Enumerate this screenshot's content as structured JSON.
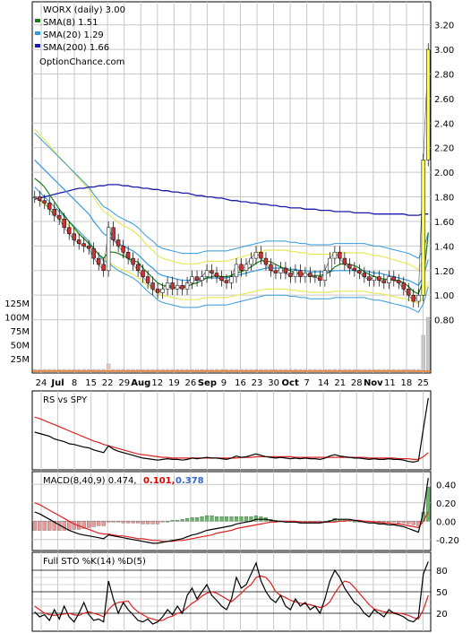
{
  "chart_data": [
    {
      "type": "candlestick",
      "panel": "price",
      "title": "WORX (daily) 3.00",
      "watermark": "OptionChance.com",
      "legend": [
        {
          "label": "SMA(8) 1.51",
          "color": "#1a7a1a"
        },
        {
          "label": "SMA(20) 1.29",
          "color": "#3399dd"
        },
        {
          "label": "SMA(200) 1.66",
          "color": "#1a1aaa"
        }
      ],
      "y_ticks": [
        "0.80",
        "1.00",
        "1.20",
        "1.40",
        "1.60",
        "1.80",
        "2.00",
        "2.20",
        "2.40",
        "2.60",
        "2.80",
        "3.00",
        "3.20"
      ],
      "ylim": [
        0.6,
        3.3
      ],
      "volume_ticks": [
        "125M",
        "100M",
        "75M",
        "50M",
        "25M"
      ],
      "x_ticks": [
        "24",
        "Jul",
        "8",
        "15",
        "22",
        "29",
        "Aug",
        "12",
        "19",
        "26",
        "Sep",
        "9",
        "16",
        "23",
        "30",
        "Oct",
        "7",
        "14",
        "21",
        "28",
        "Nov",
        "11",
        "18",
        "25"
      ],
      "grid": true,
      "legend_position": "top-left",
      "closes": [
        1.8,
        1.77,
        1.75,
        1.7,
        1.65,
        1.62,
        1.55,
        1.5,
        1.45,
        1.42,
        1.4,
        1.38,
        1.3,
        1.25,
        1.2,
        1.55,
        1.45,
        1.4,
        1.35,
        1.3,
        1.25,
        1.2,
        1.15,
        1.1,
        1.05,
        1.02,
        1.05,
        1.1,
        1.05,
        1.08,
        1.05,
        1.1,
        1.15,
        1.12,
        1.15,
        1.2,
        1.18,
        1.15,
        1.12,
        1.1,
        1.15,
        1.25,
        1.2,
        1.25,
        1.3,
        1.35,
        1.3,
        1.25,
        1.2,
        1.18,
        1.22,
        1.18,
        1.15,
        1.2,
        1.15,
        1.18,
        1.15,
        1.15,
        1.12,
        1.2,
        1.3,
        1.35,
        1.3,
        1.25,
        1.22,
        1.2,
        1.18,
        1.15,
        1.12,
        1.15,
        1.12,
        1.1,
        1.15,
        1.12,
        1.1,
        1.05,
        1.0,
        0.95,
        1.0,
        2.1,
        3.0
      ],
      "sma8": [
        1.95,
        1.92,
        1.88,
        1.82,
        1.76,
        1.7,
        1.65,
        1.6,
        1.55,
        1.5,
        1.46,
        1.42,
        1.38,
        1.33,
        1.3,
        1.35,
        1.35,
        1.34,
        1.32,
        1.3,
        1.28,
        1.27,
        1.22,
        1.18,
        1.14,
        1.1,
        1.08,
        1.07,
        1.06,
        1.06,
        1.06,
        1.07,
        1.09,
        1.1,
        1.12,
        1.14,
        1.15,
        1.16,
        1.15,
        1.15,
        1.16,
        1.18,
        1.19,
        1.21,
        1.23,
        1.26,
        1.28,
        1.28,
        1.27,
        1.25,
        1.23,
        1.21,
        1.2,
        1.18,
        1.18,
        1.17,
        1.16,
        1.16,
        1.16,
        1.17,
        1.19,
        1.23,
        1.25,
        1.26,
        1.25,
        1.24,
        1.22,
        1.19,
        1.17,
        1.15,
        1.14,
        1.13,
        1.13,
        1.12,
        1.12,
        1.1,
        1.07,
        1.03,
        1.01,
        1.12,
        1.51
      ],
      "sma20": [
        2.1,
        2.06,
        2.02,
        1.98,
        1.94,
        1.9,
        1.86,
        1.82,
        1.78,
        1.74,
        1.7,
        1.66,
        1.6,
        1.55,
        1.5,
        1.48,
        1.45,
        1.42,
        1.4,
        1.38,
        1.36,
        1.33,
        1.29,
        1.25,
        1.22,
        1.18,
        1.16,
        1.15,
        1.14,
        1.13,
        1.12,
        1.12,
        1.12,
        1.12,
        1.13,
        1.14,
        1.14,
        1.14,
        1.14,
        1.14,
        1.15,
        1.16,
        1.17,
        1.18,
        1.19,
        1.2,
        1.21,
        1.22,
        1.22,
        1.22,
        1.22,
        1.22,
        1.21,
        1.21,
        1.2,
        1.2,
        1.19,
        1.19,
        1.19,
        1.19,
        1.19,
        1.2,
        1.2,
        1.2,
        1.2,
        1.2,
        1.2,
        1.2,
        1.19,
        1.18,
        1.18,
        1.17,
        1.16,
        1.15,
        1.14,
        1.13,
        1.12,
        1.1,
        1.08,
        1.15,
        1.29
      ],
      "sma200": [
        1.78,
        1.79,
        1.8,
        1.81,
        1.82,
        1.83,
        1.84,
        1.85,
        1.86,
        1.87,
        1.87,
        1.88,
        1.88,
        1.89,
        1.89,
        1.9,
        1.9,
        1.9,
        1.89,
        1.89,
        1.88,
        1.88,
        1.87,
        1.87,
        1.86,
        1.86,
        1.85,
        1.85,
        1.84,
        1.84,
        1.83,
        1.83,
        1.82,
        1.81,
        1.81,
        1.8,
        1.8,
        1.79,
        1.79,
        1.78,
        1.77,
        1.77,
        1.76,
        1.76,
        1.75,
        1.75,
        1.74,
        1.74,
        1.73,
        1.73,
        1.72,
        1.72,
        1.71,
        1.71,
        1.71,
        1.7,
        1.7,
        1.7,
        1.69,
        1.69,
        1.69,
        1.68,
        1.68,
        1.68,
        1.68,
        1.67,
        1.67,
        1.67,
        1.67,
        1.66,
        1.66,
        1.66,
        1.66,
        1.66,
        1.66,
        1.66,
        1.65,
        1.65,
        1.65,
        1.66,
        1.66
      ]
    },
    {
      "type": "line",
      "panel": "rs",
      "title": "RS vs SPY",
      "rs": [
        0.5,
        0.48,
        0.46,
        0.44,
        0.4,
        0.38,
        0.36,
        0.33,
        0.32,
        0.3,
        0.28,
        0.27,
        0.24,
        0.22,
        0.2,
        0.3,
        0.25,
        0.22,
        0.2,
        0.18,
        0.16,
        0.14,
        0.12,
        0.11,
        0.1,
        0.09,
        0.1,
        0.11,
        0.1,
        0.1,
        0.09,
        0.1,
        0.12,
        0.11,
        0.12,
        0.13,
        0.12,
        0.12,
        0.11,
        0.1,
        0.12,
        0.15,
        0.13,
        0.14,
        0.16,
        0.18,
        0.16,
        0.14,
        0.13,
        0.12,
        0.13,
        0.12,
        0.11,
        0.12,
        0.11,
        0.12,
        0.11,
        0.11,
        0.1,
        0.12,
        0.15,
        0.17,
        0.15,
        0.14,
        0.13,
        0.12,
        0.12,
        0.11,
        0.1,
        0.11,
        0.1,
        0.1,
        0.11,
        0.1,
        0.1,
        0.09,
        0.07,
        0.06,
        0.08,
        0.55,
        1.0
      ],
      "rs_ma": [
        0.72,
        0.7,
        0.67,
        0.64,
        0.61,
        0.58,
        0.55,
        0.52,
        0.49,
        0.46,
        0.43,
        0.4,
        0.37,
        0.35,
        0.32,
        0.3,
        0.28,
        0.26,
        0.24,
        0.22,
        0.2,
        0.18,
        0.17,
        0.16,
        0.15,
        0.14,
        0.13,
        0.13,
        0.12,
        0.12,
        0.12,
        0.12,
        0.12,
        0.12,
        0.12,
        0.12,
        0.12,
        0.12,
        0.12,
        0.12,
        0.12,
        0.12,
        0.13,
        0.13,
        0.13,
        0.14,
        0.14,
        0.14,
        0.14,
        0.14,
        0.14,
        0.14,
        0.14,
        0.13,
        0.13,
        0.13,
        0.13,
        0.13,
        0.13,
        0.13,
        0.13,
        0.13,
        0.13,
        0.13,
        0.13,
        0.13,
        0.13,
        0.13,
        0.12,
        0.12,
        0.12,
        0.12,
        0.12,
        0.12,
        0.11,
        0.11,
        0.11,
        0.1,
        0.1,
        0.14,
        0.2
      ]
    },
    {
      "type": "bar",
      "panel": "macd",
      "title": "MACD(8,40,9) 0.474,",
      "value_signal": "0.101,",
      "value_hist": "0.378",
      "y_ticks": [
        "0.40",
        "0.20",
        "0.00",
        "-0.20"
      ],
      "ylim": [
        -0.28,
        0.5
      ],
      "macd": [
        0.1,
        0.08,
        0.05,
        0.02,
        -0.01,
        -0.04,
        -0.07,
        -0.1,
        -0.12,
        -0.14,
        -0.15,
        -0.16,
        -0.17,
        -0.18,
        -0.19,
        -0.15,
        -0.16,
        -0.17,
        -0.18,
        -0.19,
        -0.2,
        -0.21,
        -0.22,
        -0.23,
        -0.24,
        -0.24,
        -0.23,
        -0.22,
        -0.21,
        -0.2,
        -0.19,
        -0.17,
        -0.15,
        -0.14,
        -0.12,
        -0.1,
        -0.09,
        -0.08,
        -0.07,
        -0.06,
        -0.05,
        -0.03,
        -0.02,
        -0.01,
        0.0,
        0.02,
        0.02,
        0.02,
        0.01,
        0.0,
        0.0,
        -0.01,
        -0.01,
        -0.01,
        -0.02,
        -0.02,
        -0.02,
        -0.02,
        -0.02,
        -0.01,
        0.0,
        0.02,
        0.02,
        0.02,
        0.02,
        0.01,
        0.0,
        -0.01,
        -0.02,
        -0.02,
        -0.03,
        -0.03,
        -0.04,
        -0.04,
        -0.05,
        -0.06,
        -0.08,
        -0.1,
        -0.12,
        0.1,
        0.47
      ],
      "signal": [
        0.2,
        0.18,
        0.15,
        0.12,
        0.09,
        0.06,
        0.03,
        0.0,
        -0.03,
        -0.05,
        -0.07,
        -0.09,
        -0.11,
        -0.13,
        -0.14,
        -0.14,
        -0.15,
        -0.16,
        -0.16,
        -0.17,
        -0.18,
        -0.19,
        -0.19,
        -0.2,
        -0.21,
        -0.21,
        -0.22,
        -0.22,
        -0.22,
        -0.21,
        -0.21,
        -0.2,
        -0.19,
        -0.18,
        -0.17,
        -0.16,
        -0.15,
        -0.13,
        -0.12,
        -0.11,
        -0.1,
        -0.08,
        -0.07,
        -0.06,
        -0.05,
        -0.04,
        -0.03,
        -0.02,
        -0.01,
        -0.01,
        0.0,
        0.0,
        0.0,
        0.0,
        -0.01,
        -0.01,
        -0.01,
        -0.01,
        -0.01,
        -0.01,
        -0.01,
        -0.01,
        0.0,
        0.0,
        0.01,
        0.01,
        0.01,
        0.0,
        0.0,
        -0.01,
        -0.01,
        -0.02,
        -0.02,
        -0.03,
        -0.03,
        -0.04,
        -0.05,
        -0.06,
        -0.07,
        0.0,
        0.1
      ]
    },
    {
      "type": "line",
      "panel": "stochastic",
      "title": "Full STO %K(14) %D(5)",
      "y_ticks": [
        "80",
        "50",
        "20"
      ],
      "ylim": [
        0,
        100
      ],
      "k": [
        22,
        15,
        18,
        10,
        25,
        12,
        30,
        15,
        8,
        20,
        35,
        18,
        10,
        12,
        8,
        65,
        40,
        20,
        35,
        25,
        18,
        10,
        8,
        12,
        5,
        8,
        15,
        25,
        18,
        30,
        20,
        45,
        55,
        40,
        50,
        60,
        45,
        38,
        30,
        25,
        40,
        70,
        55,
        60,
        75,
        90,
        65,
        50,
        40,
        35,
        45,
        30,
        25,
        40,
        30,
        35,
        25,
        30,
        20,
        40,
        65,
        80,
        70,
        55,
        45,
        35,
        30,
        20,
        15,
        25,
        20,
        15,
        25,
        20,
        18,
        15,
        10,
        8,
        15,
        75,
        92
      ],
      "d": [
        30,
        25,
        20,
        18,
        17,
        18,
        19,
        20,
        18,
        17,
        20,
        22,
        20,
        18,
        15,
        25,
        32,
        35,
        36,
        37,
        28,
        22,
        18,
        14,
        12,
        10,
        10,
        14,
        16,
        20,
        22,
        28,
        34,
        38,
        44,
        48,
        50,
        48,
        44,
        40,
        36,
        42,
        48,
        55,
        60,
        70,
        72,
        70,
        62,
        50,
        45,
        42,
        38,
        36,
        34,
        33,
        32,
        30,
        28,
        30,
        36,
        48,
        58,
        65,
        63,
        56,
        48,
        40,
        32,
        26,
        24,
        22,
        21,
        21,
        20,
        19,
        17,
        14,
        12,
        25,
        45
      ]
    }
  ]
}
